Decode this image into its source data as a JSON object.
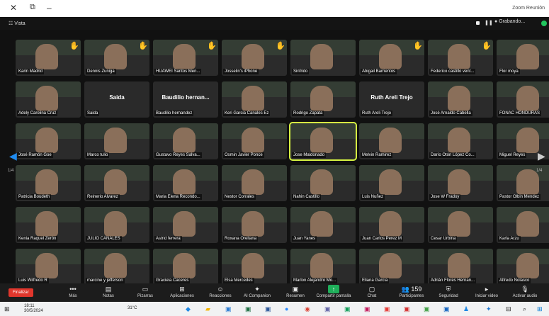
{
  "window": {
    "title": "Zoom Reunión"
  },
  "topbar": {
    "view_label": "Vista",
    "rec_label": "Grabando..."
  },
  "pager": {
    "left": "1/4",
    "right": "1/4"
  },
  "tiles": [
    {
      "name": "Karin Madrid",
      "hand": true
    },
    {
      "name": "Dennis Zuniga",
      "hand": true
    },
    {
      "name": "HUAWEI Santos Men...",
      "hand": true
    },
    {
      "name": "Josselin's iPhone",
      "hand": true
    },
    {
      "name": "Sinfrido",
      "hand": false
    },
    {
      "name": "Abigail Barrientos",
      "hand": true
    },
    {
      "name": "Federico castillo vent...",
      "hand": true
    },
    {
      "name": "Flor moya",
      "hand": true
    },
    {
      "name": "Adely Carolina Cruz",
      "hand": false
    },
    {
      "name": "Saida",
      "big": "Saida",
      "hand": false
    },
    {
      "name": "Baudilio hernandez",
      "big": "Baudilio hernan...",
      "hand": false
    },
    {
      "name": "Keri Garcia Canales Ez",
      "hand": false
    },
    {
      "name": "Rodrigo Zapata",
      "hand": false
    },
    {
      "name": "Ruth Areli Trejo",
      "big": "Ruth Areli Trejo",
      "hand": false
    },
    {
      "name": "José Arnaldo Cabella",
      "hand": false
    },
    {
      "name": "FONAC HONDURAS",
      "hand": false
    },
    {
      "name": "José Ramón Goe",
      "hand": false
    },
    {
      "name": "Marco tulio",
      "hand": false
    },
    {
      "name": "Gustavo Reyes Salva...",
      "hand": false
    },
    {
      "name": "Osmin Javier Ponce",
      "hand": false
    },
    {
      "name": "Jose Maldonado",
      "hand": false,
      "active": true
    },
    {
      "name": "Melvin Ramirez",
      "hand": false
    },
    {
      "name": "Darío Otón López Co...",
      "hand": false
    },
    {
      "name": "Miguel Reyes",
      "hand": false
    },
    {
      "name": "Patricia Boudeth",
      "hand": false
    },
    {
      "name": "Reinerio Alvarez",
      "hand": false
    },
    {
      "name": "Maria Elena Recondo...",
      "hand": false
    },
    {
      "name": "Nestor Corrales",
      "hand": false
    },
    {
      "name": "Nahin Castillo",
      "hand": false
    },
    {
      "name": "Luis Nuñez",
      "hand": false
    },
    {
      "name": "Jose W Fradoy",
      "hand": false
    },
    {
      "name": "Pastor Olbin Mendez",
      "hand": false
    },
    {
      "name": "Kenia Raquel Zerón",
      "hand": false
    },
    {
      "name": "JULIO CANALES",
      "hand": false
    },
    {
      "name": "Astrid ferrera",
      "hand": false
    },
    {
      "name": "Roxana Orellana",
      "hand": false
    },
    {
      "name": "Juan Yanes",
      "hand": false
    },
    {
      "name": "Juan Carlos Perez M",
      "hand": false
    },
    {
      "name": "Cesar Urbina",
      "hand": false
    },
    {
      "name": "Karla Arzu",
      "hand": false
    },
    {
      "name": "Luis Wilfredo R",
      "hand": false
    },
    {
      "name": "marcine y jefferson",
      "hand": false
    },
    {
      "name": "Graciela Caceres",
      "hand": false
    },
    {
      "name": "Elsa Mercedes",
      "hand": false
    },
    {
      "name": "Marlon Alejandro Mo...",
      "hand": false
    },
    {
      "name": "Eliana García",
      "hand": false
    },
    {
      "name": "Adrián Flores Hernan...",
      "hand": false
    },
    {
      "name": "Alfredo Nolasco",
      "hand": false
    }
  ],
  "toolbar": {
    "finish": "Finalizar",
    "items": [
      {
        "label": "Más",
        "icon": "•••"
      },
      {
        "label": "Notas",
        "icon": "▤"
      },
      {
        "label": "Pizarras",
        "icon": "▭"
      },
      {
        "label": "Aplicaciones",
        "icon": "⊞"
      },
      {
        "label": "Reacciones",
        "icon": "☺"
      },
      {
        "label": "AI Companion",
        "icon": "✦"
      },
      {
        "label": "Resumen",
        "icon": "▣"
      },
      {
        "label": "Compartir pantalla",
        "icon": "↑"
      },
      {
        "label": "Chat",
        "icon": "▢"
      },
      {
        "label": "Participantes",
        "icon": "👥",
        "count": "159"
      },
      {
        "label": "Seguridad",
        "icon": "⛨"
      },
      {
        "label": "Iniciar video",
        "icon": "▸"
      },
      {
        "label": "Activar audio",
        "icon": "🎙"
      }
    ]
  },
  "taskbar": {
    "time": "18:11",
    "date": "30/5/2024",
    "temp": "31°C"
  }
}
